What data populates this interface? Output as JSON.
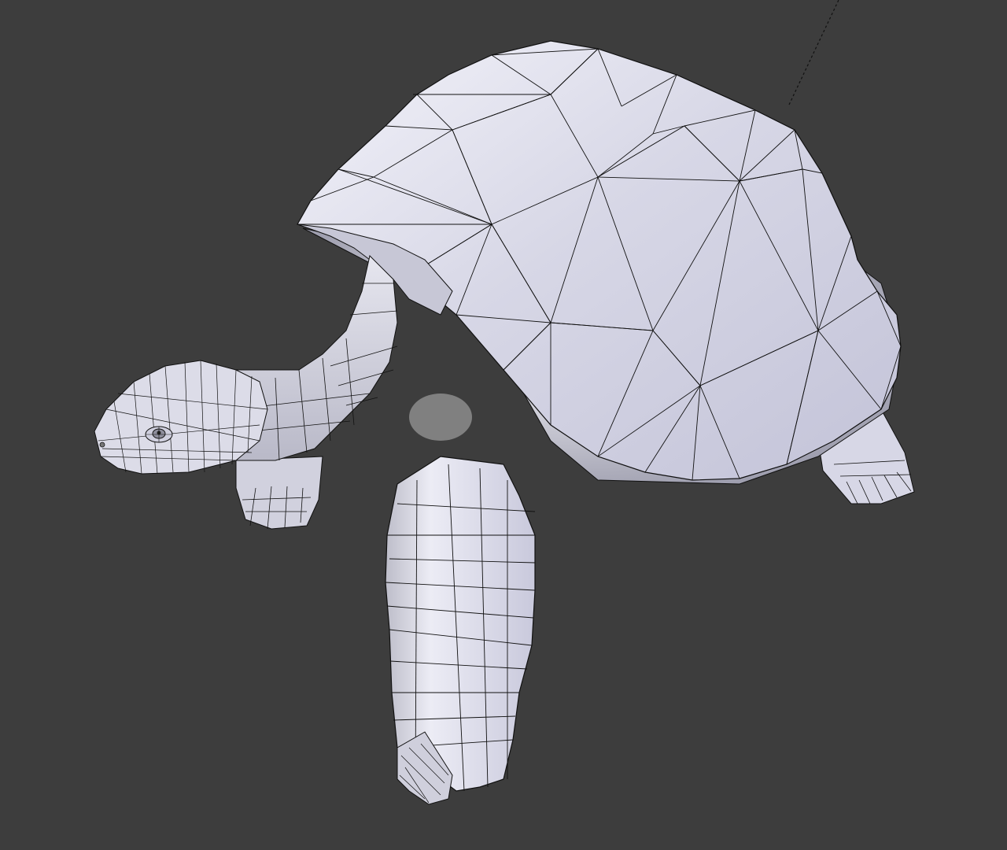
{
  "viewport": {
    "background_color": "#3d3d3d",
    "object": {
      "name": "tortoise-mesh",
      "display_mode": "solid-with-wireframe",
      "selected": false
    },
    "colors": {
      "mesh_base": "#dcdcea",
      "mesh_light": "#f4f4fb",
      "mesh_shadow": "#a9a9bd",
      "mesh_deep_shadow": "#8d8d9c",
      "wire": "#111111",
      "relationship_line": "#111111"
    }
  }
}
